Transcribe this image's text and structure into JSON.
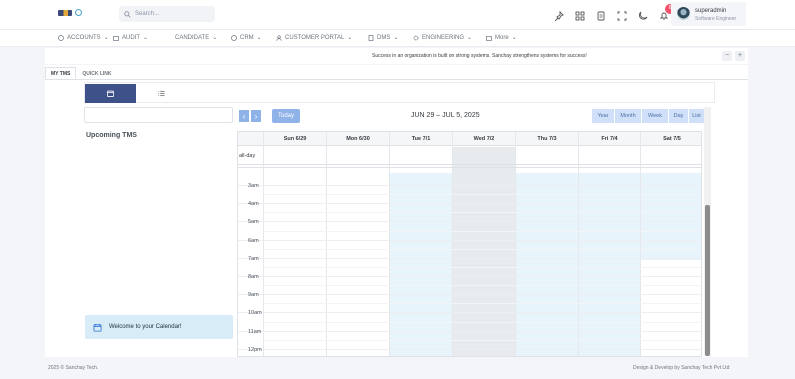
{
  "header": {
    "search_placeholder": "Search...",
    "notification_count": "6",
    "user": {
      "name": "superadmin",
      "role": "Software Engineer"
    }
  },
  "menu": [
    {
      "label": "ACCOUNTS",
      "icon": "globe-icon"
    },
    {
      "label": "AUDIT",
      "icon": "briefcase-icon"
    },
    {
      "label": "CANDIDATE",
      "icon": ""
    },
    {
      "label": "CRM",
      "icon": "globe-icon"
    },
    {
      "label": "CUSTOMER PORTAL",
      "icon": "user-icon"
    },
    {
      "label": "DMS",
      "icon": "document-icon"
    },
    {
      "label": "ENGINEERING",
      "icon": "gear-icon"
    },
    {
      "label": "More",
      "icon": "briefcase-icon"
    }
  ],
  "banner": {
    "message": "Success in an organization is built on strong systems. Sanchay strengthens systems for success!"
  },
  "tabs": [
    {
      "label": "MY TMS",
      "active": true
    },
    {
      "label": "QUICK LINK",
      "active": false
    }
  ],
  "sidebar": {
    "upcoming_title": "Upcoming TMS",
    "welcome": "Welcome to your Calendar!"
  },
  "calendar": {
    "today_label": "Today",
    "title": "JUN 29 – JUL 5, 2025",
    "views": [
      {
        "label": "Year",
        "active": false
      },
      {
        "label": "Month",
        "active": false
      },
      {
        "label": "Week",
        "active": true
      },
      {
        "label": "Day",
        "active": false
      },
      {
        "label": "List",
        "active": false
      }
    ],
    "days": [
      "Sun 6/29",
      "Mon 6/30",
      "Tue 7/1",
      "Wed 7/2",
      "Thu 7/3",
      "Fri 7/4",
      "Sat 7/5"
    ],
    "allday_label": "all-day",
    "times": [
      "3am",
      "4am",
      "5am",
      "6am",
      "7am",
      "8am",
      "9am",
      "10am",
      "11am",
      "12pm"
    ],
    "colors": {
      "business_hours": "#e8f4fb",
      "today": "#e8ebee",
      "accent": "#2e6fd6"
    }
  },
  "footer": {
    "left": "2025 © Sanchay Tech.",
    "right": "Design & Develop by Sanchay Tech Pvt Ltd"
  }
}
